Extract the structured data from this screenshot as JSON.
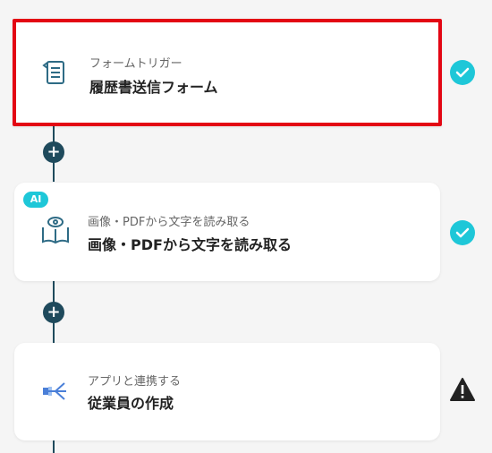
{
  "steps": [
    {
      "subtitle": "フォームトリガー",
      "title": "履歴書送信フォーム",
      "icon": "form-icon",
      "status": "check"
    },
    {
      "subtitle": "画像・PDFから文字を読み取る",
      "title": "画像・PDFから文字を読み取る",
      "icon": "book-eye-icon",
      "status": "check",
      "badge": "AI"
    },
    {
      "subtitle": "アプリと連携する",
      "title": "従業員の作成",
      "icon": "app-integration-icon",
      "status": "warning"
    }
  ],
  "add_label": "+",
  "colors": {
    "accent": "#1ec7d8",
    "line": "#1f4a5c",
    "highlight": "#e30613"
  }
}
